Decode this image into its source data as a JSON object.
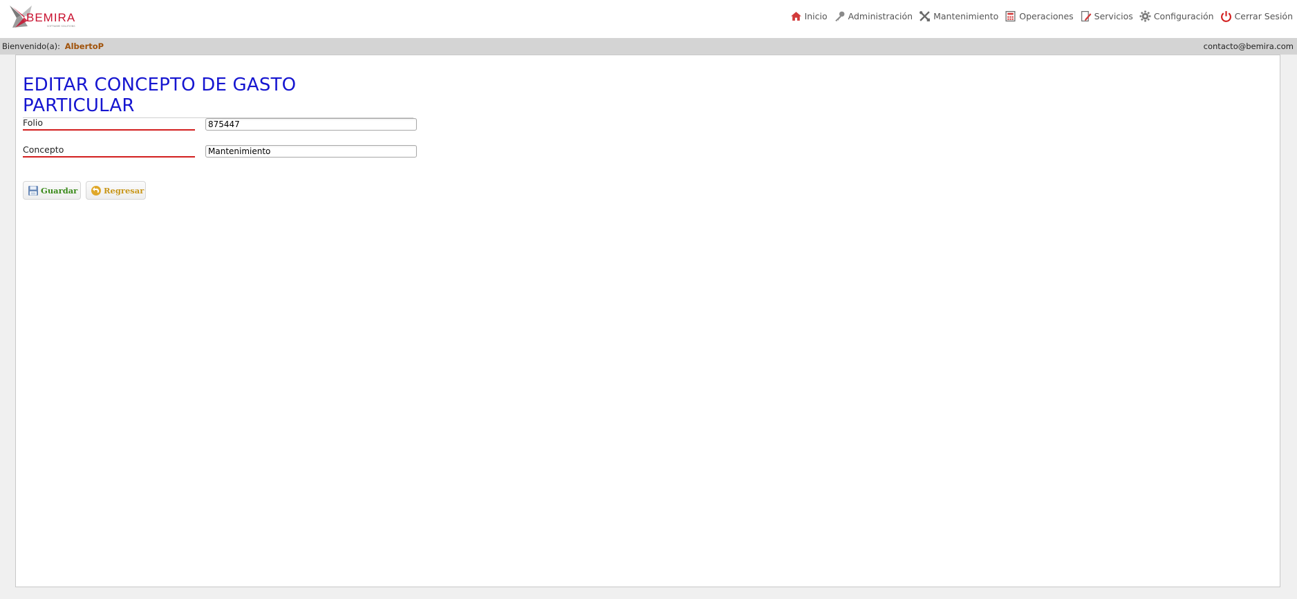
{
  "header": {
    "logo_text": "BEMIRA",
    "logo_tagline": "SOFTWARE SOLUTIONS",
    "nav": [
      {
        "label": "Inicio",
        "icon": "home-icon"
      },
      {
        "label": "Administración",
        "icon": "key-icon"
      },
      {
        "label": "Mantenimiento",
        "icon": "tools-icon"
      },
      {
        "label": "Operaciones",
        "icon": "calculator-icon"
      },
      {
        "label": "Servicios",
        "icon": "edit-document-icon"
      },
      {
        "label": "Configuración",
        "icon": "gear-icon"
      },
      {
        "label": "Cerrar Sesión",
        "icon": "power-icon"
      }
    ]
  },
  "welcome": {
    "prefix": "Bienvenido(a):",
    "user": "AlbertoP",
    "contact": "contacto@bemira.com"
  },
  "form": {
    "title": "EDITAR CONCEPTO DE GASTO PARTICULAR",
    "fields": [
      {
        "label": "Folio",
        "value": "875447"
      },
      {
        "label": "Concepto",
        "value": "Mantenimiento"
      }
    ],
    "save_label": "Guardar",
    "back_label": "Regresar"
  },
  "colors": {
    "title": "#1515d0",
    "label_underline": "#d21e1e",
    "save_text": "#3a8a1a",
    "back_text": "#c8961a",
    "welcome_user": "#a0520a",
    "welcome_bar": "#d4d4d4"
  }
}
